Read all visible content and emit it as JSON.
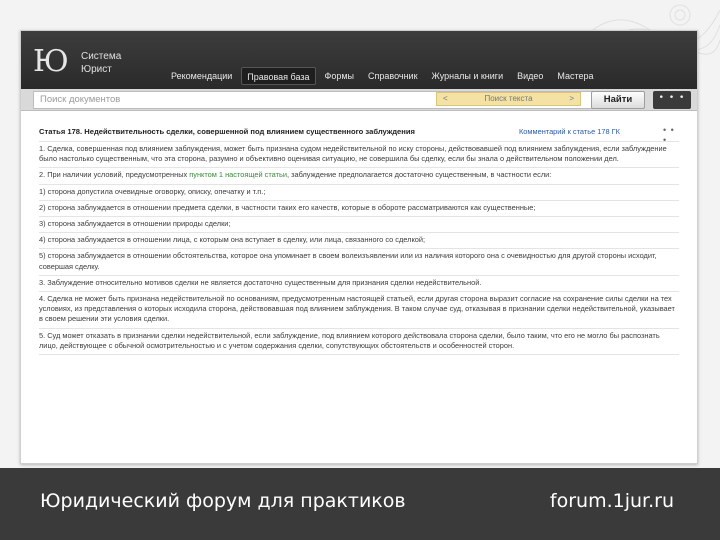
{
  "colors": {
    "topbar": "#333333",
    "footer": "#3a3a3a",
    "find_highlight": "#f3e2a3",
    "link_blue": "#2a5aa8",
    "link_green": "#3a8a3a"
  },
  "app": {
    "logo_mark": "Ю",
    "logo_line1": "Система",
    "logo_line2": "Юрист"
  },
  "nav": {
    "items": [
      {
        "label": "Рекомендации"
      },
      {
        "label": "Правовая база"
      },
      {
        "label": "Формы"
      },
      {
        "label": "Справочник"
      },
      {
        "label": "Журналы и книги"
      },
      {
        "label": "Видео"
      },
      {
        "label": "Мастера"
      }
    ],
    "active_index": 1
  },
  "search": {
    "placeholder": "Поиск документов",
    "find_prev": "<",
    "find_label": "Поиск текста",
    "find_next": ">",
    "button_label": "Найти",
    "more_label": "• • •"
  },
  "document": {
    "title": "Статья 178. Недействительность сделки, совершенной под влиянием существенного заблуждения",
    "side_link": "Комментарий к статье 178 ГК",
    "menu_label": "• • •",
    "p1": "1. Сделка, совершенная под влиянием заблуждения, может быть признана судом недействительной по иску стороны, действовавшей под влиянием заблуждения, если заблуждение было настолько существенным, что эта сторона, разумно и объективно оценивая ситуацию, не совершила бы сделку, если бы знала о действительном положении дел.",
    "p2_before": "2. При наличии условий, предусмотренных ",
    "p2_link": "пунктом 1 настоящей статьи",
    "p2_after": ", заблуждение предполагается достаточно существенным, в частности если:",
    "p3": "1) сторона допустила очевидные оговорку, описку, опечатку и т.п.;",
    "p4": "2) сторона заблуждается в отношении предмета сделки, в частности таких его качеств, которые в обороте рассматриваются как существенные;",
    "p5": "3) сторона заблуждается в отношении природы сделки;",
    "p6": "4) сторона заблуждается в отношении лица, с которым она вступает в сделку, или лица, связанного со сделкой;",
    "p7": "5) сторона заблуждается в отношении обстоятельства, которое она упоминает в своем волеизъявлении или из наличия которого она с очевидностью для другой стороны исходит, совершая сделку.",
    "p8": "3. Заблуждение относительно мотивов сделки не является достаточно существенным для признания сделки недействительной.",
    "p9": "4. Сделка не может быть признана недействительной по основаниям, предусмотренным настоящей статьей, если другая сторона выразит согласие на сохранение силы сделки на тех условиях, из представления о которых исходила сторона, действовавшая под влиянием заблуждения. В таком случае суд, отказывая в признании сделки недействительной, указывает в своем решении эти условия сделки.",
    "p10": "5. Суд может отказать в признании сделки недействительной, если заблуждение, под влиянием которого действовала сторона сделки, было таким, что его не могло бы распознать лицо, действующее с обычной осмотрительностью и с учетом содержания сделки, сопутствующих обстоятельств и особенностей сторон."
  },
  "footer": {
    "tagline": "Юридический форум для практиков",
    "url": "forum.1jur.ru"
  }
}
